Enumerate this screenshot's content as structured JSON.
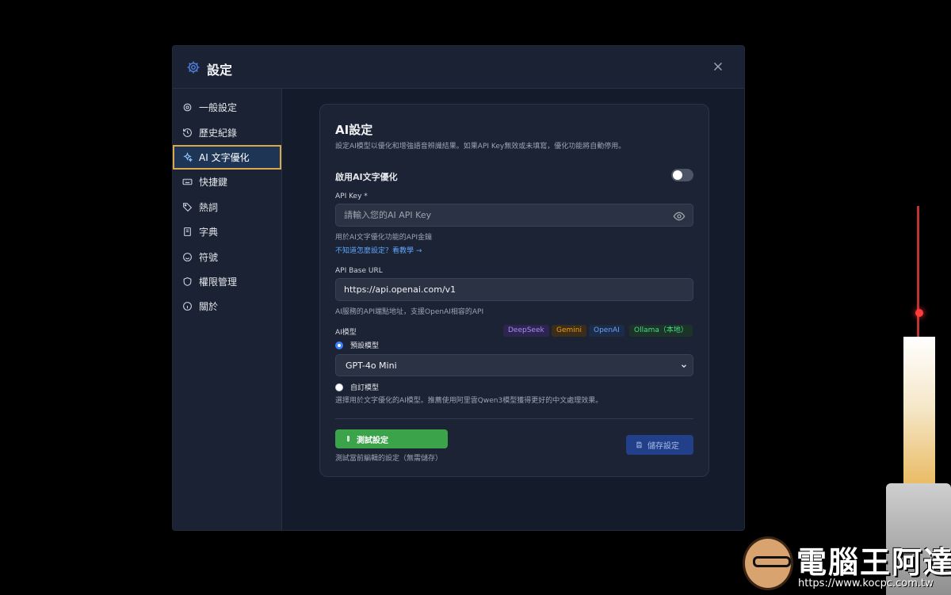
{
  "dialog": {
    "title": "設定",
    "close_icon": "close-icon"
  },
  "sidebar": {
    "items": [
      {
        "label": "一般設定",
        "icon": "gear-icon"
      },
      {
        "label": "歷史紀錄",
        "icon": "history-icon"
      },
      {
        "label": "AI 文字優化",
        "icon": "sparkles-icon",
        "active": true
      },
      {
        "label": "快捷鍵",
        "icon": "keyboard-icon"
      },
      {
        "label": "熱詞",
        "icon": "tag-icon"
      },
      {
        "label": "字典",
        "icon": "book-icon"
      },
      {
        "label": "符號",
        "icon": "smile-icon"
      },
      {
        "label": "權限管理",
        "icon": "shield-icon"
      },
      {
        "label": "關於",
        "icon": "info-icon"
      }
    ]
  },
  "ai": {
    "title": "AI設定",
    "description": "設定AI模型以優化和增強語音辨識結果。如果API Key無效或未填寫，優化功能將自動停用。",
    "enable_label": "啟用AI文字優化",
    "enable_on": false,
    "api_key": {
      "label": "API Key *",
      "placeholder": "請輸入您的AI API Key",
      "value": "",
      "help": "用於AI文字優化功能的API金鑰",
      "tutorial_link": "不知道怎麼設定？看教學 →"
    },
    "base_url": {
      "label": "API Base URL",
      "value": "https://api.openai.com/v1",
      "help": "AI服務的API端點地址，支援OpenAI相容的API"
    },
    "model": {
      "label": "AI模型",
      "providers": [
        {
          "name": "DeepSeek",
          "color": "#a78bfa",
          "bg": "#2e2450"
        },
        {
          "name": "Gemini",
          "color": "#f59e0b",
          "bg": "#3a2e1a"
        },
        {
          "name": "OpenAI",
          "color": "#60a5fa",
          "bg": "#1e2b47"
        },
        {
          "name": "Ollama（本地）",
          "color": "#4ade80",
          "bg": "#1b3329"
        }
      ],
      "preset_label": "預設模型",
      "selected": "GPT-4o Mini",
      "custom_label": "自訂模型",
      "help": "選擇用於文字優化的AI模型。推薦使用阿里雲Qwen3模型獲得更好的中文處理效果。"
    },
    "test_button": "測試設定",
    "test_help": "測試當前編輯的設定（無需儲存）",
    "save_button": "儲存設定"
  },
  "watermark": {
    "title": "電腦王阿達",
    "url": "https://www.kocpc.com.tw"
  },
  "colors": {
    "accent": "#3b82f6",
    "active_border": "#d8a84a",
    "test_green": "#3ba44a",
    "save_blue": "#22408a"
  }
}
